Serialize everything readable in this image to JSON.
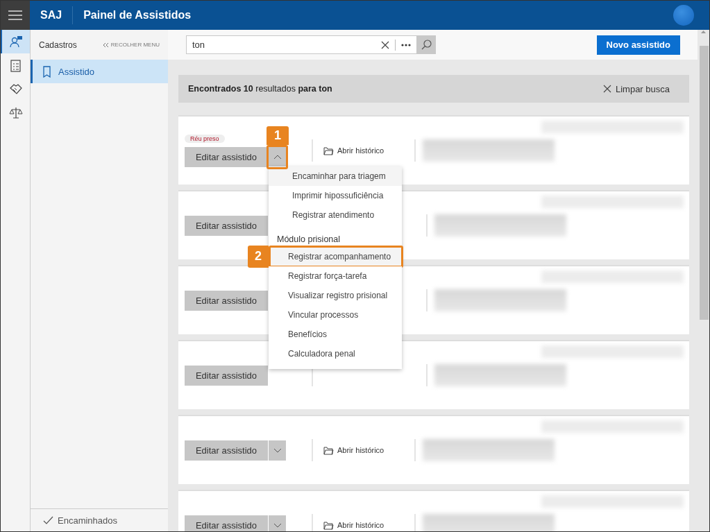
{
  "header": {
    "brand": "SAJ",
    "title": "Painel de Assistidos"
  },
  "rail": {
    "items": [
      {
        "kind": "person",
        "selected": true
      },
      {
        "kind": "clipboard",
        "selected": false
      },
      {
        "kind": "handshake",
        "selected": false
      },
      {
        "kind": "scales",
        "selected": false
      }
    ]
  },
  "sidebar": {
    "heading": "Cadastros",
    "collapse_link": "RECOLHER MENU",
    "items": [
      {
        "label": "Assistido",
        "selected": true
      }
    ],
    "footer_item": "Encaminhados"
  },
  "search": {
    "value": "ton"
  },
  "new_button": "Novo assistido",
  "results_banner": {
    "text": "**Encontrados 10** resultados **para ton**",
    "clear": "Limpar busca"
  },
  "cards": [
    {
      "tag": "Réu preso",
      "edit": "Editar assistido",
      "expanded": true,
      "callout": "1",
      "history": "Abrir histórico"
    },
    {
      "edit": "Editar assistido"
    },
    {
      "edit": "Editar assistido"
    },
    {
      "edit": "Editar assistido"
    },
    {
      "edit": "Editar assistido",
      "expanded": false,
      "history": "Abrir histórico"
    },
    {
      "edit": "Editar assistido",
      "expanded": false,
      "history": "Abrir histórico"
    }
  ],
  "menu": {
    "groups": [
      {
        "items": [
          {
            "label": "Encaminhar para triagem",
            "highlighted": true
          },
          {
            "label": "Imprimir hipossuficiência",
            "highlighted": false
          },
          {
            "label": "Registrar atendimento",
            "highlighted": false
          }
        ]
      },
      {
        "heading": "Módulo prisional",
        "items": [
          {
            "label": "Registrar acompanhamento",
            "highlighted": true,
            "callout": "2"
          },
          {
            "label": "Registrar força-tarefa",
            "highlighted": false
          },
          {
            "label": "Visualizar registro prisional",
            "highlighted": false
          },
          {
            "label": "Vincular processos",
            "highlighted": false
          },
          {
            "label": "Benefícios",
            "highlighted": false
          },
          {
            "label": "Calculadora penal",
            "highlighted": false
          }
        ]
      }
    ]
  }
}
